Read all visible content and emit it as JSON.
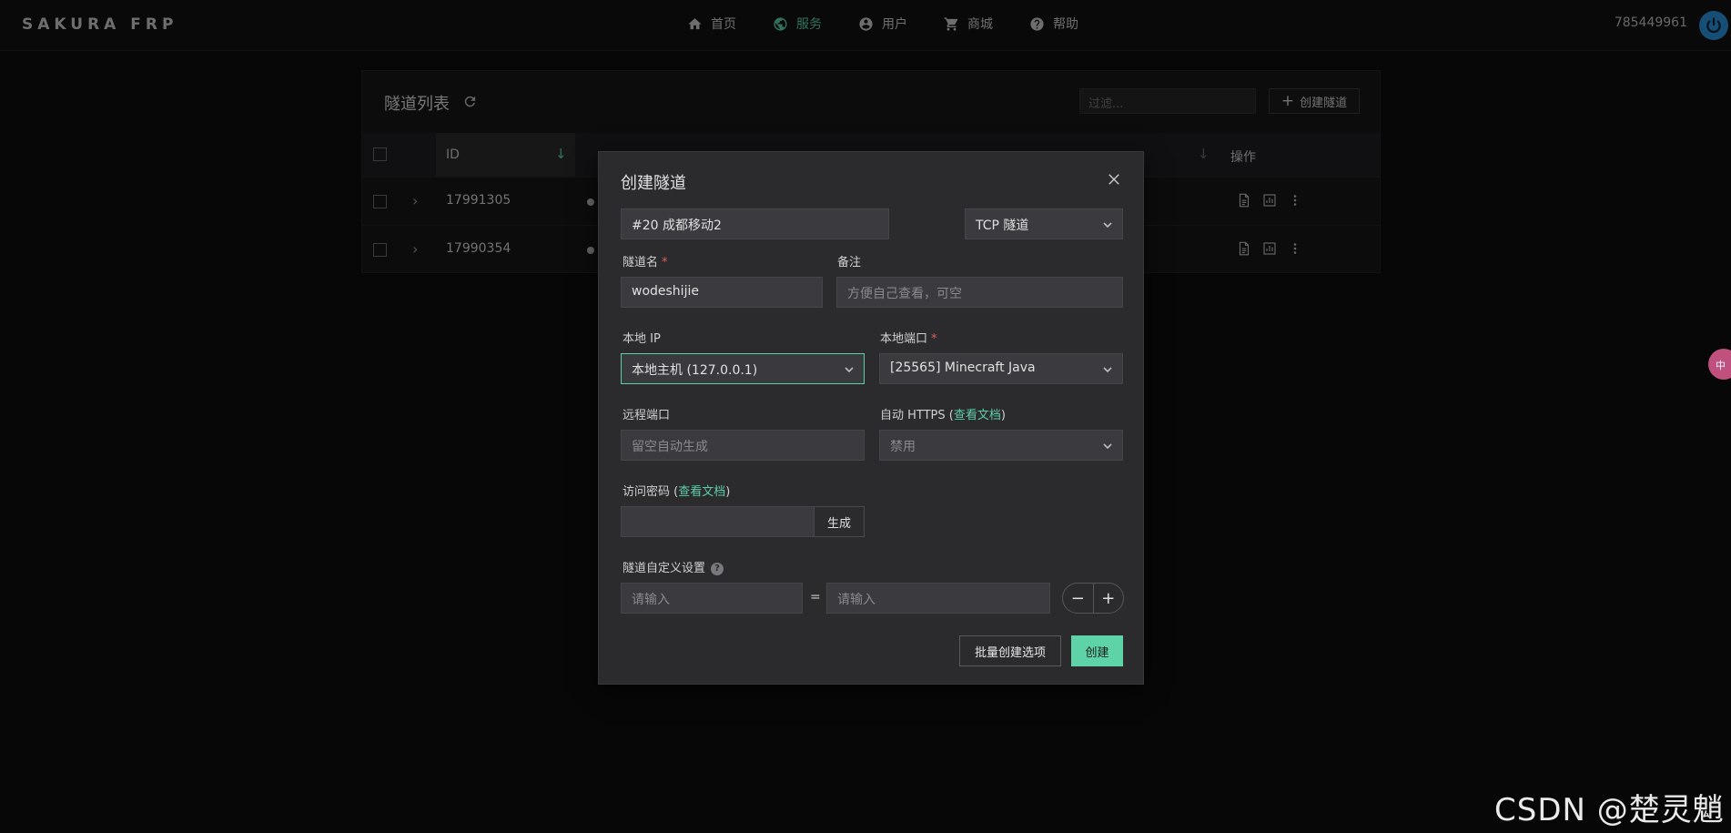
{
  "brand": "SAKURA FRP",
  "nav": {
    "items": [
      {
        "label": "首页",
        "icon": "home-icon",
        "active": false
      },
      {
        "label": "服务",
        "icon": "globe-icon",
        "active": true
      },
      {
        "label": "用户",
        "icon": "user-circle-icon",
        "active": false
      },
      {
        "label": "商城",
        "icon": "cart-icon",
        "active": false
      },
      {
        "label": "帮助",
        "icon": "help-circle-icon",
        "active": false
      }
    ],
    "user_id": "785449961"
  },
  "tunnel_list": {
    "title": "隧道列表",
    "filter_placeholder": "过滤...",
    "create_label": "创建隧道",
    "columns": {
      "id": "ID",
      "ops": "操作"
    },
    "rows": [
      {
        "id": "17991305"
      },
      {
        "id": "17990354"
      }
    ]
  },
  "modal": {
    "title": "创建隧道",
    "node": "#20 成都移动2",
    "type": "TCP 隧道",
    "name_label": "隧道名",
    "name_value": "wodeshijie",
    "note_label": "备注",
    "note_placeholder": "方便自己查看，可空",
    "local_ip_label": "本地 IP",
    "local_ip_value": "本地主机 (127.0.0.1)",
    "local_port_label": "本地端口",
    "local_port_value": "[25565] Minecraft Java",
    "remote_port_label": "远程端口",
    "remote_port_placeholder": "留空自动生成",
    "https_label": "自动 HTTPS (",
    "https_doc": "查看文档",
    "https_close": ")",
    "https_value": "禁用",
    "password_label": "访问密码 (",
    "password_doc": "查看文档",
    "password_close": ")",
    "generate_label": "生成",
    "custom_label": "隧道自定义设置",
    "custom_key_placeholder": "请输入",
    "custom_value_placeholder": "请输入",
    "equals": "=",
    "minus": "−",
    "plus": "+",
    "batch_label": "批量创建选项",
    "confirm_label": "创建",
    "required_mark": "*"
  },
  "side_tab": "中",
  "watermark": "CSDN @楚灵魈",
  "colors": {
    "accent": "#5ccfa5",
    "power": "#2a8ed8",
    "required": "#e25c5c"
  }
}
